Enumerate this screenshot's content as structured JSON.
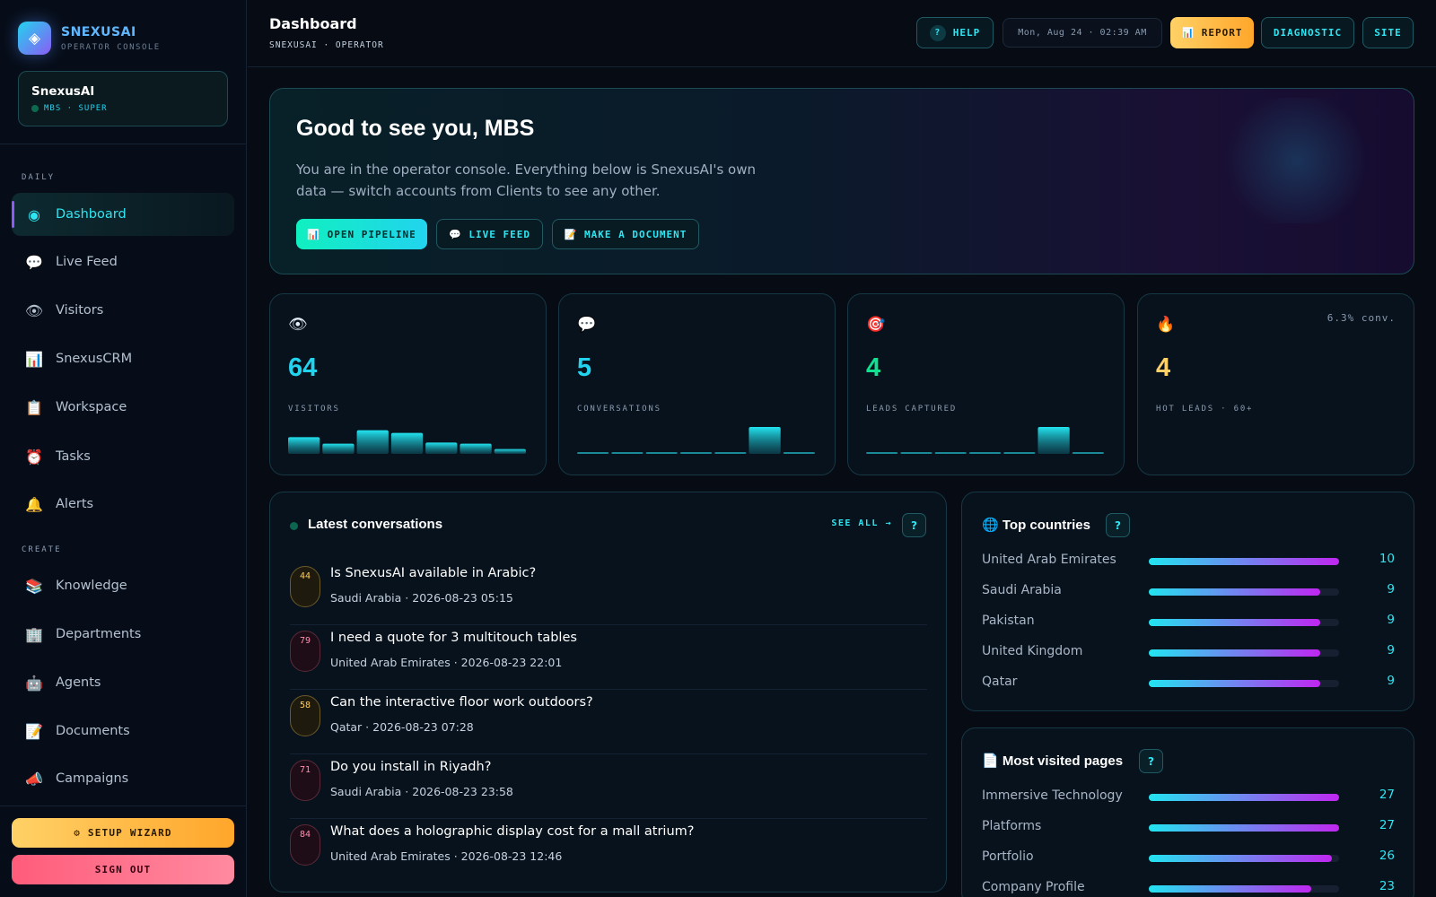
{
  "brand": {
    "name": "SNEXUSAI",
    "subtitle": "OPERATOR CONSOLE",
    "logo_icon": "◈"
  },
  "account": {
    "name": "SnexusAI",
    "role": "MBS · SUPER"
  },
  "sidebar": {
    "sections": {
      "daily": "DAILY",
      "create": "CREATE"
    },
    "daily_items": [
      {
        "label": "Dashboard",
        "icon": "◉",
        "icon_name": "target-icon"
      },
      {
        "label": "Live Feed",
        "icon": "💬",
        "icon_name": "chat-icon"
      },
      {
        "label": "Visitors",
        "icon": "👁",
        "icon_name": "eye-icon"
      },
      {
        "label": "SnexusCRM",
        "icon": "📊",
        "icon_name": "chart-icon"
      },
      {
        "label": "Workspace",
        "icon": "📋",
        "icon_name": "clipboard-icon"
      },
      {
        "label": "Tasks",
        "icon": "⏰",
        "icon_name": "alarm-icon"
      },
      {
        "label": "Alerts",
        "icon": "🔔",
        "icon_name": "bell-icon"
      }
    ],
    "create_items": [
      {
        "label": "Knowledge",
        "icon": "📚",
        "icon_name": "books-icon"
      },
      {
        "label": "Departments",
        "icon": "🏢",
        "icon_name": "building-icon"
      },
      {
        "label": "Agents",
        "icon": "🤖",
        "icon_name": "robot-icon"
      },
      {
        "label": "Documents",
        "icon": "📝",
        "icon_name": "memo-icon"
      },
      {
        "label": "Campaigns",
        "icon": "📣",
        "icon_name": "megaphone-icon"
      }
    ],
    "setup_wizard": "⚙ SETUP WIZARD",
    "sign_out": "SIGN OUT"
  },
  "header": {
    "title": "Dashboard",
    "breadcrumb": "SNEXUSAI · OPERATOR",
    "help": "HELP",
    "help_icon": "?",
    "clock": "Mon, Aug 24 · 02:39 AM",
    "report": "📊 REPORT",
    "diagnostic": "DIAGNOSTIC",
    "site": "SITE"
  },
  "hero": {
    "title": "Good to see you, MBS",
    "description": "You are in the operator console. Everything below is SnexusAI's own data — switch accounts from Clients to see any other.",
    "buttons": [
      "📊 OPEN PIPELINE",
      "💬 LIVE FEED",
      "📝 MAKE A DOCUMENT"
    ]
  },
  "stats": [
    {
      "icon": "👁",
      "icon_name": "eye-icon",
      "value": "64",
      "label": "VISITORS",
      "color": "#22d3ee",
      "extra": "",
      "spark": [
        0.62,
        0.38,
        0.88,
        0.78,
        0.42,
        0.38,
        0.18
      ]
    },
    {
      "icon": "💬",
      "icon_name": "chat-icon",
      "value": "5",
      "label": "CONVERSATIONS",
      "color": "#22d3ee",
      "extra": "",
      "spark": [
        0,
        0,
        0,
        0,
        0,
        1,
        0
      ]
    },
    {
      "icon": "🎯",
      "icon_name": "target-icon",
      "value": "4",
      "label": "LEADS CAPTURED",
      "color": "#10e090",
      "extra": "",
      "spark": [
        0,
        0,
        0,
        0,
        0,
        1,
        0
      ]
    },
    {
      "icon": "🔥",
      "icon_name": "fire-icon",
      "value": "4",
      "label": "HOT LEADS · 60+",
      "color": "#ffd166",
      "extra": "6.3% conv.",
      "spark": []
    }
  ],
  "conversations": {
    "title": "Latest conversations",
    "see_all": "SEE ALL →",
    "help_icon": "?",
    "items": [
      {
        "score": "44",
        "tone": "amber",
        "question": "Is SnexusAI available in Arabic?",
        "meta": "Saudi Arabia · 2026-08-23 05:15"
      },
      {
        "score": "79",
        "tone": "rose",
        "question": "I need a quote for 3 multitouch tables",
        "meta": "United Arab Emirates · 2026-08-23 22:01"
      },
      {
        "score": "58",
        "tone": "amber",
        "question": "Can the interactive floor work outdoors?",
        "meta": "Qatar · 2026-08-23 07:28"
      },
      {
        "score": "71",
        "tone": "rose",
        "question": "Do you install in Riyadh?",
        "meta": "Saudi Arabia · 2026-08-23 23:58"
      },
      {
        "score": "84",
        "tone": "rose",
        "question": "What does a holographic display cost for a mall atrium?",
        "meta": "United Arab Emirates · 2026-08-23 12:46"
      }
    ]
  },
  "top_countries": {
    "title": "Top countries",
    "icon": "🌐",
    "help_icon": "?",
    "max": 10,
    "items": [
      {
        "label": "United Arab Emirates",
        "value": 10
      },
      {
        "label": "Saudi Arabia",
        "value": 9
      },
      {
        "label": "Pakistan",
        "value": 9
      },
      {
        "label": "United Kingdom",
        "value": 9
      },
      {
        "label": "Qatar",
        "value": 9
      }
    ]
  },
  "top_pages": {
    "title": "Most visited pages",
    "icon": "📄",
    "help_icon": "?",
    "max": 27,
    "items": [
      {
        "label": "Immersive Technology",
        "value": 27
      },
      {
        "label": "Platforms",
        "value": 27
      },
      {
        "label": "Portfolio",
        "value": 26
      },
      {
        "label": "Company Profile",
        "value": 23
      }
    ]
  }
}
